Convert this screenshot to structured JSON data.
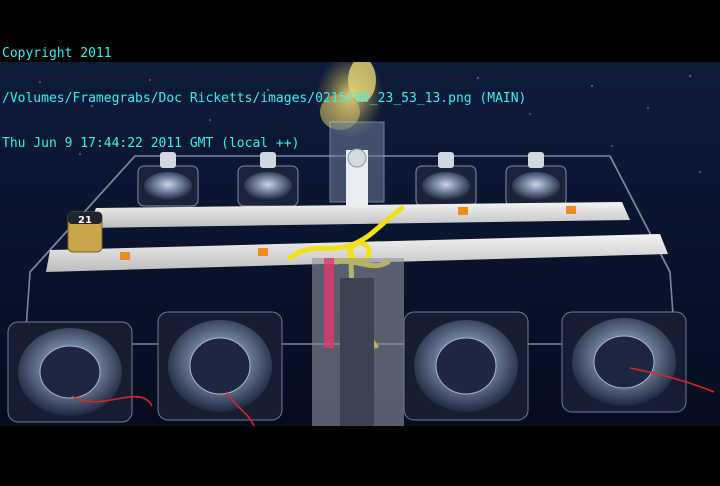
{
  "overlay": {
    "line1": "Copyright 2011",
    "line2": "/Volumes/Framegrabs/Doc Ricketts/images/0215/00_23_53_13.png (MAIN)",
    "line3": "Thu Jun 9 17:44:22 2011 GMT (local ++)"
  },
  "photo": {
    "label_21": "21"
  },
  "colors": {
    "overlay_text": "#33f0f0",
    "water": "#0a1630",
    "yellow_line": "#f2e01a",
    "sediment_plume": "#d8c46a"
  }
}
